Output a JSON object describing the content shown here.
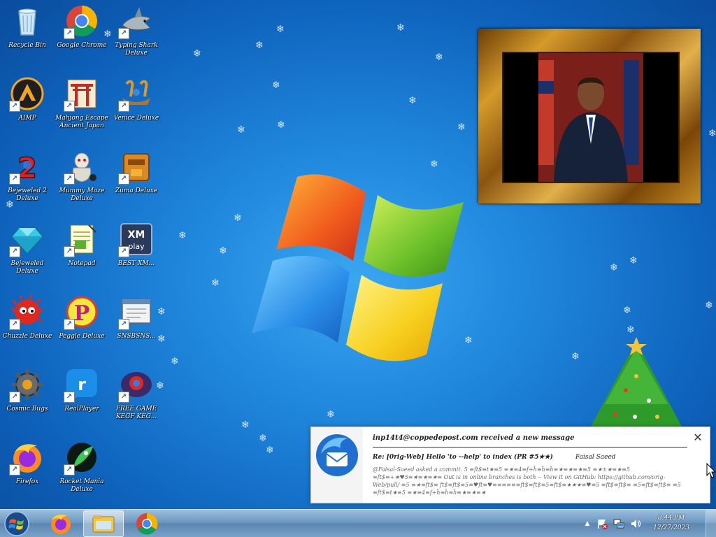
{
  "desktop": {
    "icons": [
      {
        "label": "Recycle Bin",
        "icon": "recycle-bin-icon",
        "shortcut": false
      },
      {
        "label": "Google Chrome",
        "icon": "chrome-icon",
        "shortcut": true
      },
      {
        "label": "Typing Shark Deluxe",
        "icon": "shark-icon",
        "shortcut": true
      },
      {
        "label": "AIMP",
        "icon": "aimp-icon",
        "shortcut": true
      },
      {
        "label": "Mahjong Escape Ancient Japan",
        "icon": "torii-gate-icon",
        "shortcut": true
      },
      {
        "label": "Venice Deluxe",
        "icon": "venice-icon",
        "shortcut": true
      },
      {
        "label": "Bejeweled 2 Deluxe",
        "icon": "bejeweled2-icon",
        "shortcut": true
      },
      {
        "label": "Mummy Maze Deluxe",
        "icon": "mummy-icon",
        "shortcut": true
      },
      {
        "label": "Zuma Deluxe",
        "icon": "zuma-icon",
        "shortcut": true
      },
      {
        "label": "Bejeweled Deluxe",
        "icon": "diamond-icon",
        "shortcut": true
      },
      {
        "label": "Notepad",
        "icon": "notepad-icon",
        "shortcut": true
      },
      {
        "label": "BEST XM...",
        "icon": "xmplay-icon",
        "shortcut": true
      },
      {
        "label": "Chuzzle Deluxe",
        "icon": "chuzzle-icon",
        "shortcut": true
      },
      {
        "label": "Peggle Deluxe",
        "icon": "peggle-icon",
        "shortcut": true
      },
      {
        "label": "SNSBSNS...",
        "icon": "window-app-icon",
        "shortcut": true
      },
      {
        "label": "Cosmic Bugs",
        "icon": "gear-icon",
        "shortcut": true
      },
      {
        "label": "RealPlayer",
        "icon": "realplayer-icon",
        "shortcut": true
      },
      {
        "label": "FREE GAME KEGF KEG...",
        "icon": "thunderbird-game-icon",
        "shortcut": true
      },
      {
        "label": "Firefox",
        "icon": "firefox-icon",
        "shortcut": true
      },
      {
        "label": "Rocket Mania Deluxe",
        "icon": "rocket-icon",
        "shortcut": true
      }
    ]
  },
  "notification": {
    "title": "inp14t4@coppedepost.com received a new message",
    "subject": "Re: [0rig-Web] Hello 'to --help' to index (PR #5★★)",
    "sender": "Faisal Saeed",
    "body": "@Faisal-Saeed asked a commit. 5 ≡ft$≡t★≡5 ≡★≡4≡f+ĥ≡ĥ≡ĥ≡★≡★≡★≡5 ≡★±★≡★≡5 ≡ft$≡+★♥5≡★≡★≡★≡ Out is in online branches is both -- View it on GitHub: https://github.com/orig-Web/pull/ ≡5 ≡★≡ft$≡ ft$≡ft$≡5≡♥ft≡♥≡≡≡≡≡≡ft$≡ft$≡5≡ft$≡★★★≡♥≡5 ≡ft$≡ft$≡ ≡5≡ft$≡ft$≡ ≡5 ≡ft$≡t★≡5 ≡★≡4≡f+ĥ≡ĥ≡ĥ≡★≡★≡★",
    "close_symbol": "✕"
  },
  "taskbar": {
    "items": [
      {
        "name": "firefox",
        "icon": "firefox-icon"
      },
      {
        "name": "file-explorer",
        "icon": "folder-icon",
        "active": true
      },
      {
        "name": "chrome",
        "icon": "chrome-icon"
      }
    ],
    "tray": {
      "show_hidden": "▲",
      "clock_time": "8:44 PM",
      "clock_date": "12/27/2023"
    }
  },
  "colors": {
    "desktop_bg": "#1f86dc",
    "taskbar": "#6e97bf",
    "toast_bg": "#ffffff"
  }
}
